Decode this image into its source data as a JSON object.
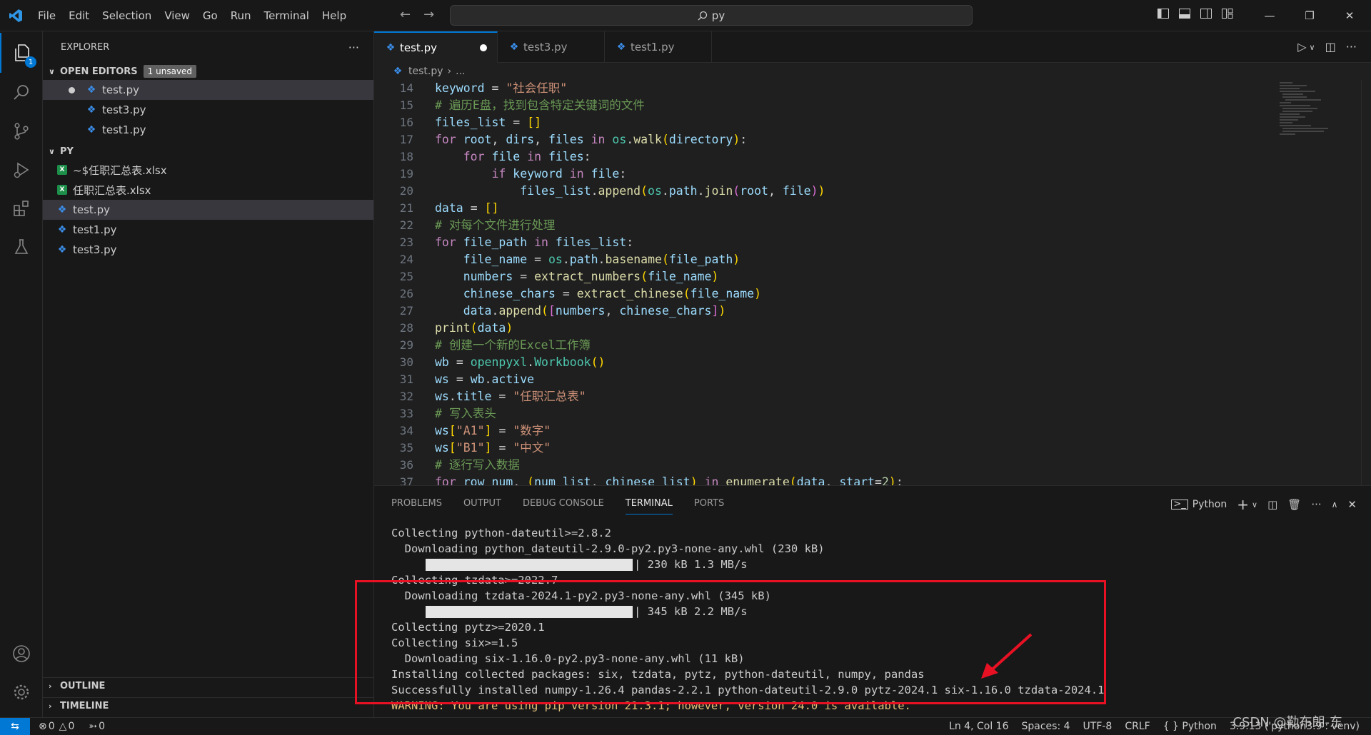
{
  "menu": [
    "File",
    "Edit",
    "Selection",
    "View",
    "Go",
    "Run",
    "Terminal",
    "Help"
  ],
  "search": {
    "value": "py"
  },
  "activity": {
    "explorer_badge": "1"
  },
  "sidebar": {
    "title": "EXPLORER",
    "open_editors": {
      "label": "OPEN EDITORS",
      "badge": "1 unsaved",
      "files": [
        "test.py",
        "test3.py",
        "test1.py"
      ]
    },
    "folder": {
      "label": "PY",
      "files": [
        "~$任职汇总表.xlsx",
        "任职汇总表.xlsx",
        "test.py",
        "test1.py",
        "test3.py"
      ]
    },
    "outline": "OUTLINE",
    "timeline": "TIMELINE"
  },
  "tabs": [
    "test.py",
    "test3.py",
    "test1.py"
  ],
  "breadcrumb": {
    "file": "test.py",
    "rest": "..."
  },
  "code": {
    "line_numbers": [
      "14",
      "15",
      "16",
      "17",
      "18",
      "19",
      "20",
      "21",
      "22",
      "23",
      "24",
      "25",
      "26",
      "27",
      "28",
      "29",
      "30",
      "31",
      "32",
      "33",
      "34",
      "35",
      "36",
      "37"
    ]
  },
  "panel": {
    "tabs": [
      "PROBLEMS",
      "OUTPUT",
      "DEBUG CONSOLE",
      "TERMINAL",
      "PORTS"
    ],
    "shell": "Python",
    "lines": [
      "Collecting python-dateutil>=2.8.2",
      "  Downloading python_dateutil-2.9.0-py2.py3-none-any.whl (230 kB)",
      "| 230 kB 1.3 MB/s",
      "Collecting tzdata>=2022.7",
      "  Downloading tzdata-2024.1-py2.py3-none-any.whl (345 kB)",
      "| 345 kB 2.2 MB/s",
      "Collecting pytz>=2020.1",
      "Collecting six>=1.5",
      "  Downloading six-1.16.0-py2.py3-none-any.whl (11 kB)",
      "Installing collected packages: six, tzdata, pytz, python-dateutil, numpy, pandas",
      "Successfully installed numpy-1.26.4 pandas-2.2.1 python-dateutil-2.9.0 pytz-2024.1 six-1.16.0 tzdata-2024.1",
      "WARNING: You are using pip version 21.3.1; however, version 24.0 is available."
    ]
  },
  "status": {
    "errors": "0",
    "warnings": "0",
    "ports": "0",
    "position": "Ln 4, Col 16",
    "spaces": "Spaces: 4",
    "encoding": "UTF-8",
    "eol": "CRLF",
    "language": "Python",
    "interpreter": "3.9.13 ('python3.9': venv)"
  },
  "watermark": "CSDN @勒布朗-东",
  "colors": {
    "accent": "#0078d4",
    "highlight_box": "#e81123"
  }
}
